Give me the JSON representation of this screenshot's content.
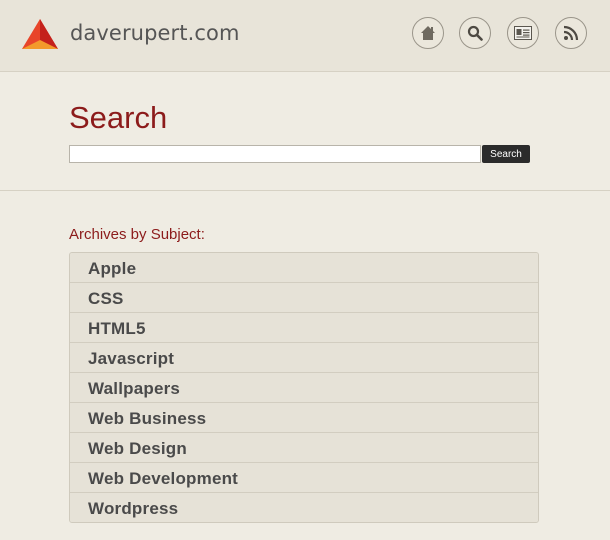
{
  "header": {
    "site_name": "daverupert.com",
    "nav": [
      {
        "icon": "home-icon"
      },
      {
        "icon": "search-icon"
      },
      {
        "icon": "contact-card-icon"
      },
      {
        "icon": "rss-icon"
      }
    ]
  },
  "search": {
    "title": "Search",
    "input_value": "",
    "button_label": "Search"
  },
  "archives": {
    "heading": "Archives by Subject:",
    "items": [
      "Apple",
      "CSS",
      "HTML5",
      "Javascript",
      "Wallpapers",
      "Web Business",
      "Web Design",
      "Web Development",
      "Wordpress"
    ]
  },
  "colors": {
    "accent": "#8c1b1b",
    "background": "#efece3",
    "button": "#2b2b2b"
  }
}
